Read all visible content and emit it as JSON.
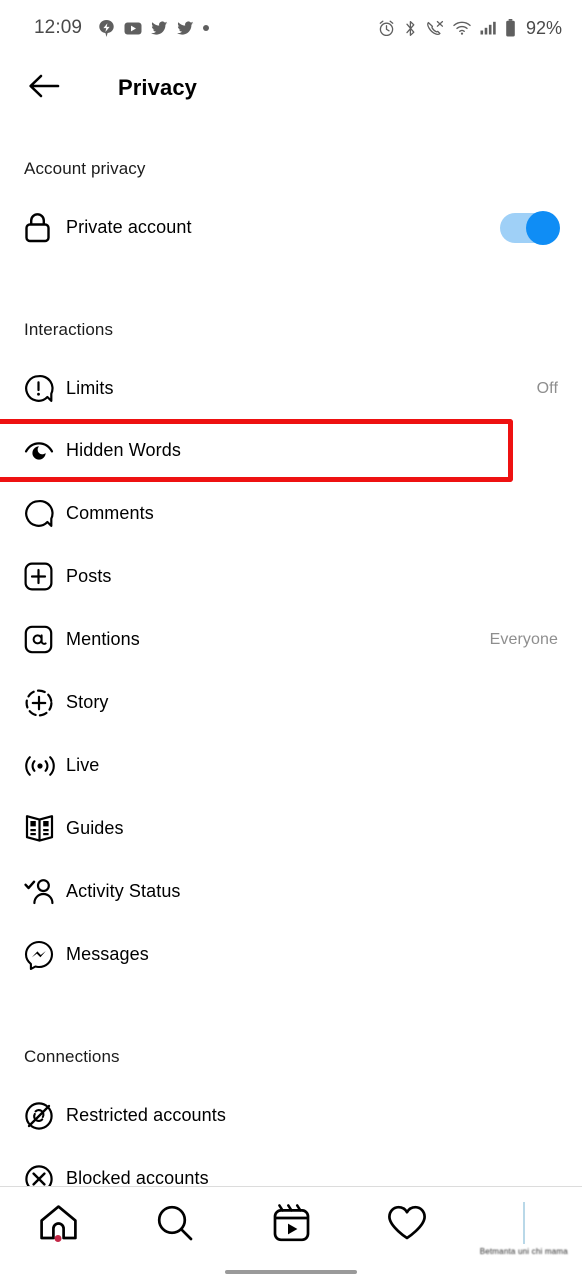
{
  "status_bar": {
    "clock": "12:09",
    "battery_percent": "92%",
    "left_icons": [
      "notification-badge-icon",
      "youtube-icon",
      "twitter-icon",
      "twitter-icon",
      "dot-icon"
    ],
    "right_icons": [
      "alarm-icon",
      "bluetooth-icon",
      "call-mute-icon",
      "wifi-icon",
      "cellular-signal-icon",
      "battery-icon"
    ]
  },
  "header": {
    "title": "Privacy",
    "back_icon": "arrow-left-icon"
  },
  "sections": [
    {
      "id": "account-privacy",
      "title": "Account privacy",
      "rows": [
        {
          "id": "private-account",
          "icon": "lock-icon",
          "label": "Private account",
          "control": "toggle",
          "toggle_on": true,
          "value": ""
        }
      ]
    },
    {
      "id": "interactions",
      "title": "Interactions",
      "rows": [
        {
          "id": "limits",
          "icon": "exclamation-bubble-icon",
          "label": "Limits",
          "value": "Off",
          "highlighted": false
        },
        {
          "id": "hidden-words",
          "icon": "hidden-words-icon",
          "label": "Hidden Words",
          "value": "",
          "highlighted": true
        },
        {
          "id": "comments",
          "icon": "comment-bubble-icon",
          "label": "Comments",
          "value": "",
          "highlighted": false
        },
        {
          "id": "posts",
          "icon": "plus-square-icon",
          "label": "Posts",
          "value": "",
          "highlighted": false
        },
        {
          "id": "mentions",
          "icon": "at-sign-icon",
          "label": "Mentions",
          "value": "Everyone",
          "highlighted": false
        },
        {
          "id": "story",
          "icon": "story-plus-icon",
          "label": "Story",
          "value": "",
          "highlighted": false
        },
        {
          "id": "live",
          "icon": "live-broadcast-icon",
          "label": "Live",
          "value": "",
          "highlighted": false
        },
        {
          "id": "guides",
          "icon": "guides-book-icon",
          "label": "Guides",
          "value": "",
          "highlighted": false
        },
        {
          "id": "activity-status",
          "icon": "person-check-icon",
          "label": "Activity Status",
          "value": "",
          "highlighted": false
        },
        {
          "id": "messages",
          "icon": "messenger-icon",
          "label": "Messages",
          "value": "",
          "highlighted": false
        }
      ]
    },
    {
      "id": "connections",
      "title": "Connections",
      "rows": [
        {
          "id": "restricted-accounts",
          "icon": "restricted-account-icon",
          "label": "Restricted accounts",
          "value": "",
          "highlighted": false
        },
        {
          "id": "blocked-accounts",
          "icon": "blocked-account-icon",
          "label": "Blocked accounts",
          "value": "",
          "highlighted": false
        }
      ]
    }
  ],
  "bottom_nav": {
    "items": [
      {
        "id": "home",
        "icon": "home-icon",
        "badge": true
      },
      {
        "id": "search",
        "icon": "search-icon",
        "badge": false
      },
      {
        "id": "reels",
        "icon": "reels-icon",
        "badge": false
      },
      {
        "id": "activity",
        "icon": "heart-icon",
        "badge": false
      }
    ],
    "profile": {
      "id": "profile",
      "icon": "profile-avatar-icon",
      "caption": "Betmanta uni chi mama"
    }
  },
  "colors": {
    "accent_blue": "#0f8df5",
    "toggle_track": "#9fd0f7",
    "highlight_red": "#ee1111",
    "badge_red": "#c42847",
    "muted_text": "#8e8e8e",
    "divider": "#dcdcdc"
  }
}
